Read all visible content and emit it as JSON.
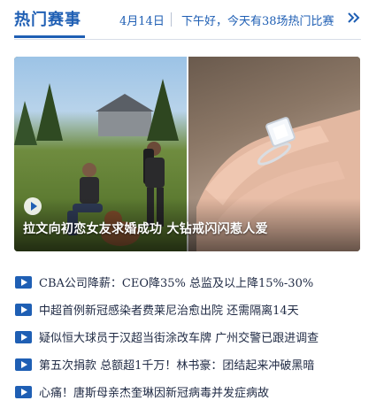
{
  "header": {
    "title": "热门赛事",
    "date": "4月14日",
    "greeting": "下午好，今天有38场热门比赛"
  },
  "hero": {
    "caption": "拉文向初恋女友求婚成功 大钻戒闪闪惹人爱"
  },
  "news": [
    {
      "title": "CBA公司降薪：CEO降35% 总监及以上降15%-30%"
    },
    {
      "title": "中超首例新冠感染者费莱尼治愈出院 还需隔离14天"
    },
    {
      "title": "疑似恒大球员于汉超当街涂改车牌 广州交警已跟进调查"
    },
    {
      "title": "第五次捐款 总额超1千万！林书豪：团结起来冲破黑暗"
    },
    {
      "title": "心痛！唐斯母亲杰奎琳因新冠病毒并发症病故"
    }
  ],
  "colors": {
    "accent": "#1f5fb4",
    "text": "#1f2a44",
    "divider": "#d7dde8"
  }
}
